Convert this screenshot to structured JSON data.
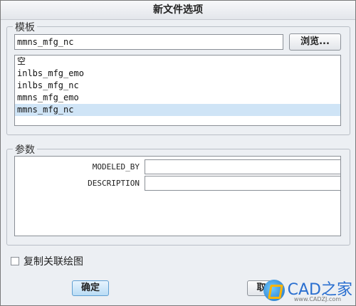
{
  "window": {
    "title": "新文件选项"
  },
  "template_group": {
    "label": "模板",
    "input_value": "mmns_mfg_nc",
    "browse_label": "浏览...",
    "items": [
      {
        "label": "空"
      },
      {
        "label": "inlbs_mfg_emo"
      },
      {
        "label": "inlbs_mfg_nc"
      },
      {
        "label": "mmns_mfg_emo"
      },
      {
        "label": "mmns_mfg_nc"
      }
    ],
    "selected_index": 4
  },
  "params_group": {
    "label": "参数",
    "fields": [
      {
        "label": "MODELED_BY",
        "value": ""
      },
      {
        "label": "DESCRIPTION",
        "value": ""
      }
    ]
  },
  "copy_drawing": {
    "label": "复制关联绘图",
    "checked": false
  },
  "buttons": {
    "ok": "确定",
    "cancel": "取"
  },
  "watermark": {
    "text": "CAD之家",
    "url": "www.CADZJ.com"
  }
}
